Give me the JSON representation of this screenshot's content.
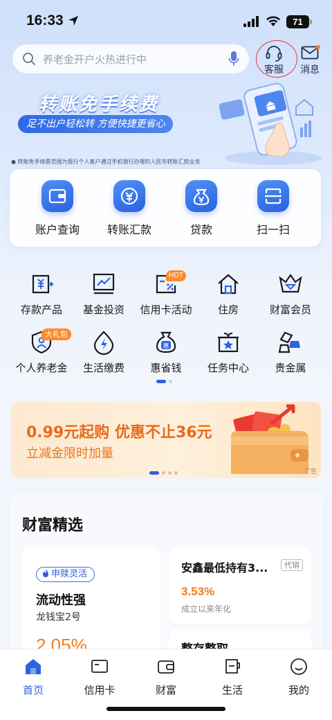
{
  "status": {
    "time": "16:33",
    "battery": "71"
  },
  "search": {
    "placeholder": "养老金开户火热进行中"
  },
  "header": {
    "service_label": "客服",
    "message_label": "消息"
  },
  "banner": {
    "title": "转账免手续费",
    "subtitle": "足不出户轻松转 方便快捷更省心",
    "note": "● 转账免手续费范围为我行个人客户通过手机银行办理的人民币转账汇款业务"
  },
  "quick_actions": [
    {
      "label": "账户查询",
      "icon": "wallet-icon"
    },
    {
      "label": "转账汇款",
      "icon": "transfer-icon"
    },
    {
      "label": "贷款",
      "icon": "money-bag-icon"
    },
    {
      "label": "扫一扫",
      "icon": "scan-icon"
    }
  ],
  "grid": [
    {
      "label": "存款产品",
      "icon": "deposit-icon"
    },
    {
      "label": "基金投资",
      "icon": "fund-chart-icon"
    },
    {
      "label": "信用卡活动",
      "icon": "credit-card-promo-icon",
      "badge": "HOT"
    },
    {
      "label": "住房",
      "icon": "house-icon"
    },
    {
      "label": "财富会员",
      "icon": "diamond-crown-icon"
    },
    {
      "label": "个人养老金",
      "icon": "shield-person-icon",
      "badge": "大礼包"
    },
    {
      "label": "生活缴费",
      "icon": "lightning-drop-icon"
    },
    {
      "label": "惠省钱",
      "icon": "savings-bag-icon",
      "inner": "惠"
    },
    {
      "label": "任务中心",
      "icon": "gift-star-icon"
    },
    {
      "label": "贵金属",
      "icon": "gold-bars-icon"
    }
  ],
  "promo": {
    "title": "0.99元起购 优惠不止36元",
    "subtitle": "立减金限时加量",
    "ad_tag": "广告"
  },
  "wealth": {
    "title": "财富精选",
    "featured": {
      "chip": "申赎灵活",
      "name": "流动性强",
      "product": "龙钱宝2号",
      "rate": "2.05%"
    },
    "items": [
      {
        "name": "安鑫最低持有3...",
        "tag": "代销",
        "rate": "3.53%",
        "desc": "成立以来年化"
      },
      {
        "name": "整存整取"
      }
    ]
  },
  "tabs": [
    {
      "label": "首页",
      "icon": "home-icon",
      "active": true
    },
    {
      "label": "信用卡",
      "icon": "card-icon"
    },
    {
      "label": "财富",
      "icon": "wallet-icon"
    },
    {
      "label": "生活",
      "icon": "cup-icon"
    },
    {
      "label": "我的",
      "icon": "smile-icon"
    }
  ],
  "colors": {
    "primary": "#2c63e0",
    "accent_orange": "#f07e1a",
    "service_ring": "#e23b3b"
  }
}
